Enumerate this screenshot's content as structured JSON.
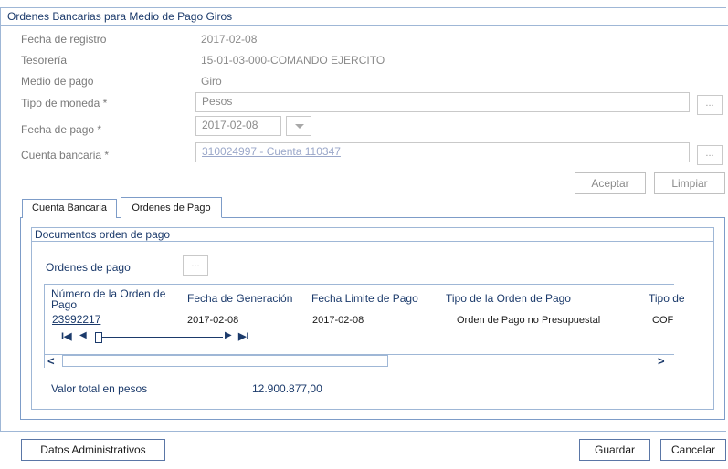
{
  "window": {
    "title": "Ordenes Bancarias para Medio de Pago Giros"
  },
  "form": {
    "fecha_registro": {
      "label": "Fecha de registro",
      "value": "2017-02-08"
    },
    "tesoreria": {
      "label": "Tesorería",
      "value": "15-01-03-000-COMANDO EJERCITO"
    },
    "medio_pago": {
      "label": "Medio de pago",
      "value": "Giro"
    },
    "tipo_moneda": {
      "label": "Tipo de moneda *",
      "value": "Pesos",
      "button": "..."
    },
    "fecha_pago": {
      "label": "Fecha de pago *",
      "value": "2017-02-08"
    },
    "cuenta_bancaria": {
      "label": "Cuenta bancaria *",
      "value": "310024997 - Cuenta 110347",
      "button": "..."
    },
    "aceptar_label": "Aceptar",
    "limpiar_label": "Limpiar"
  },
  "tabs": [
    {
      "label": "Cuenta Bancaria"
    },
    {
      "label": "Ordenes de Pago"
    }
  ],
  "documentos": {
    "title": "Documentos orden de pago",
    "ordenes_label": "Ordenes de pago",
    "ordenes_button": "...",
    "columns": [
      "Número de la Orden de Pago",
      "Fecha de Generación",
      "Fecha Limite de Pago",
      "Tipo de la Orden de Pago",
      "Tipo de"
    ],
    "rows": [
      [
        "23992217",
        "2017-02-08",
        "2017-02-08",
        "Orden de Pago no Presupuestal",
        "COF"
      ]
    ],
    "pager": {
      "first": "I◀",
      "prev": "◀",
      "next": "▶",
      "last": "▶I"
    },
    "scroll_left": "<",
    "scroll_right": ">",
    "valor_total_label": "Valor total en pesos",
    "valor_total": "12.900.877,00"
  },
  "footer": {
    "datos_admin_label": "Datos Administrativos",
    "guardar_label": "Guardar",
    "cancelar_label": "Cancelar"
  },
  "colors": {
    "accent": "#1b3a6b",
    "border": "#9fb7d6",
    "muted": "#8a8a8a"
  }
}
